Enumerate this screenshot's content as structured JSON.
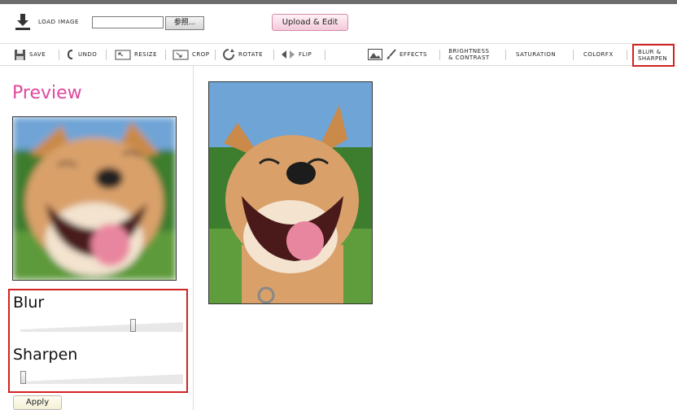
{
  "load": {
    "label": "LOAD IMAGE",
    "browse_label": "参照...",
    "file_value": ""
  },
  "upload_button": "Upload & Edit",
  "toolbar": {
    "save": "SAVE",
    "undo": "UNDO",
    "resize": "RESIZE",
    "crop": "CROP",
    "rotate": "ROTATE",
    "flip": "FLIP",
    "effects": "EFFECTS",
    "brightness_line1": "BRIGHTNESS",
    "brightness_line2": "& CONTRAST",
    "saturation": "SATURATION",
    "colorfx": "COLORFX",
    "blur_line1": "BLUR &",
    "blur_line2": "SHARPEN"
  },
  "preview": {
    "title": "Preview"
  },
  "blur_panel": {
    "blur_label": "Blur",
    "sharpen_label": "Sharpen",
    "blur_value": 0.7,
    "sharpen_value": 0.0
  },
  "apply_button": "Apply",
  "colors": {
    "accent": "#e0489c",
    "highlight": "#d32222"
  }
}
